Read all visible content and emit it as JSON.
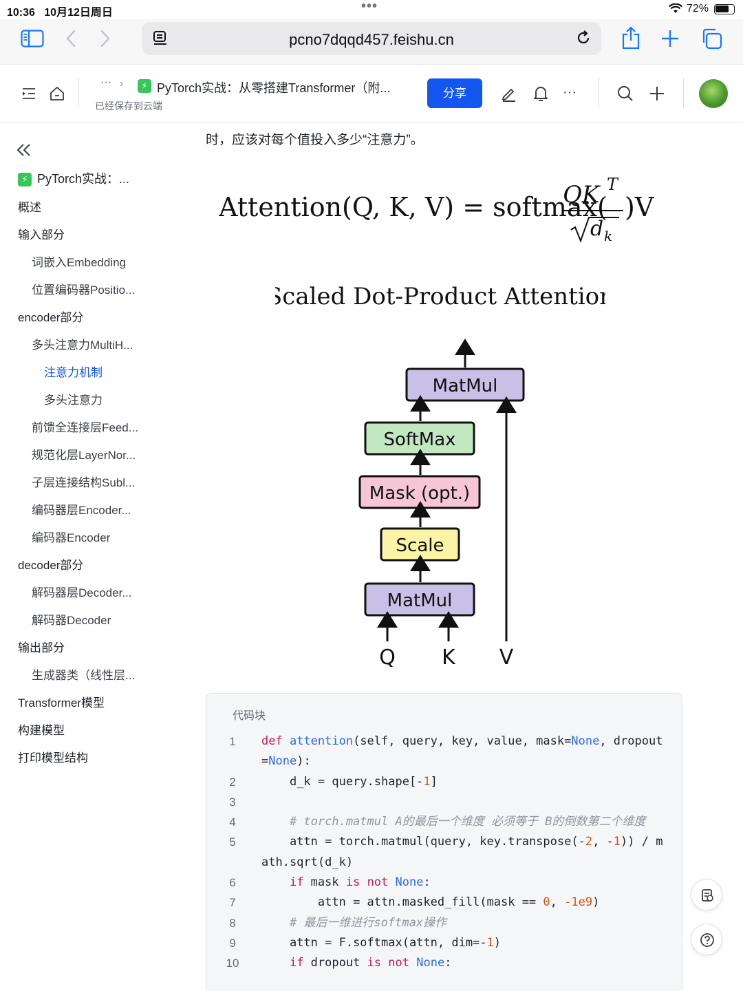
{
  "status_bar": {
    "time": "10:36",
    "date": "10月12日周日",
    "battery_pct": "72%",
    "battery_level": 0.72
  },
  "browser": {
    "url": "pcno7dqqd457.feishu.cn"
  },
  "toolbar": {
    "breadcrumb_more": "···",
    "doc_title": "PyTorch实战：从零搭建Transformer（附...",
    "saved_status": "已经保存到云端",
    "share_label": "分享",
    "more_label": "···"
  },
  "sidebar": {
    "doc_title": "PyTorch实战：...",
    "toc": [
      {
        "label": "概述",
        "level": 1
      },
      {
        "label": "输入部分",
        "level": 1
      },
      {
        "label": "词嵌入Embedding",
        "level": 2
      },
      {
        "label": "位置编码器Positio...",
        "level": 2
      },
      {
        "label": "encoder部分",
        "level": 1
      },
      {
        "label": "多头注意力MultiH...",
        "level": 2
      },
      {
        "label": "注意力机制",
        "level": 3,
        "active": true
      },
      {
        "label": "多头注意力",
        "level": 3
      },
      {
        "label": "前馈全连接层Feed...",
        "level": 2
      },
      {
        "label": "规范化层LayerNor...",
        "level": 2
      },
      {
        "label": "子层连接结构Subl...",
        "level": 2
      },
      {
        "label": "编码器层Encoder...",
        "level": 2
      },
      {
        "label": "编码器Encoder",
        "level": 2
      },
      {
        "label": "decoder部分",
        "level": 1
      },
      {
        "label": "解码器层Decoder...",
        "level": 2
      },
      {
        "label": "解码器Decoder",
        "level": 2
      },
      {
        "label": "输出部分",
        "level": 1
      },
      {
        "label": "生成器类（线性层...",
        "level": 2
      },
      {
        "label": "Transformer模型",
        "level": 1
      },
      {
        "label": "构建模型",
        "level": 1
      },
      {
        "label": "打印模型结构",
        "level": 1
      }
    ]
  },
  "content": {
    "intro_text": "时，应该对每个值投入多少“注意力”。",
    "formula": {
      "lhs": "Attention(Q, K, V) = softmax(",
      "numerator": "QK",
      "numerator_sup": "T",
      "denominator": "d",
      "denominator_sub": "k",
      "rhs": ")V"
    },
    "diagram": {
      "title": "Scaled Dot-Product Attention",
      "boxes": [
        {
          "label": "MatMul",
          "color": "#c9c0e8"
        },
        {
          "label": "SoftMax",
          "color": "#c2e8c2"
        },
        {
          "label": "Mask (opt.)",
          "color": "#f7c6d6"
        },
        {
          "label": "Scale",
          "color": "#fbf3a6"
        },
        {
          "label": "MatMul",
          "color": "#c9c0e8"
        }
      ],
      "inputs": [
        "Q",
        "K",
        "V"
      ]
    },
    "code_block": {
      "title": "代码块",
      "lines": [
        {
          "n": "1",
          "html_tokens": [
            [
              "kw",
              "def "
            ],
            [
              "fn",
              "attention"
            ],
            [
              "",
              "(self, query, key, value, mask="
            ],
            [
              "bi",
              "None"
            ],
            [
              "",
              ", dropout="
            ],
            [
              "bi",
              "None"
            ],
            [
              "",
              "):"
            ]
          ]
        },
        {
          "n": "2",
          "html_tokens": [
            [
              "",
              "    d_k = query.shape[-"
            ],
            [
              "num",
              "1"
            ],
            [
              "",
              "]"
            ]
          ]
        },
        {
          "n": "3",
          "html_tokens": [
            [
              "",
              ""
            ]
          ]
        },
        {
          "n": "4",
          "html_tokens": [
            [
              "cm",
              "    # torch.matmul A的最后一个维度 必须等于 B的倒数第二个维度"
            ]
          ]
        },
        {
          "n": "5",
          "html_tokens": [
            [
              "",
              "    attn = torch.matmul(query, key.transpose(-"
            ],
            [
              "num",
              "2"
            ],
            [
              "",
              ", -"
            ],
            [
              "num",
              "1"
            ],
            [
              "",
              "))"
            ],
            [
              "",
              " / math.sqrt(d_k)"
            ]
          ]
        },
        {
          "n": "6",
          "html_tokens": [
            [
              "kw",
              "    if"
            ],
            [
              "",
              " mask "
            ],
            [
              "kw",
              "is not"
            ],
            [
              "",
              " "
            ],
            [
              "bi",
              "None"
            ],
            [
              "",
              ":"
            ]
          ]
        },
        {
          "n": "7",
          "html_tokens": [
            [
              "",
              "        attn = attn.masked_fill(mask == "
            ],
            [
              "num",
              "0"
            ],
            [
              "",
              ", "
            ],
            [
              "num",
              "-1e9"
            ],
            [
              "",
              ")"
            ]
          ]
        },
        {
          "n": "8",
          "html_tokens": [
            [
              "cm",
              "    # 最后一维进行softmax操作"
            ]
          ]
        },
        {
          "n": "9",
          "html_tokens": [
            [
              "",
              "    attn = F.softmax(attn, dim=-"
            ],
            [
              "num",
              "1"
            ],
            [
              "",
              ")"
            ]
          ]
        },
        {
          "n": "10",
          "html_tokens": [
            [
              "kw",
              "    if"
            ],
            [
              "",
              " dropout "
            ],
            [
              "kw",
              "is not"
            ],
            [
              "",
              " "
            ],
            [
              "bi",
              "None"
            ],
            [
              "",
              ":"
            ]
          ]
        }
      ]
    }
  },
  "icons": {
    "sidebar_toggle": "sidebar-icon",
    "back": "chevron-left-icon",
    "forward": "chevron-right-icon",
    "reader": "reader-icon",
    "reload": "reload-icon",
    "share": "share-icon",
    "new_tab": "plus-icon",
    "tabs": "tabs-icon",
    "outline": "outline-icon",
    "home": "home-icon",
    "edit": "pen-icon",
    "notify": "bell-icon",
    "search": "search-icon",
    "add": "plus-icon",
    "collapse": "double-chevron-left-icon",
    "float_comment": "comment-icon",
    "float_help": "help-icon"
  },
  "colors": {
    "accent": "#1456f0",
    "active_toc": "#1456f0",
    "browser_blue": "#1677ff"
  }
}
